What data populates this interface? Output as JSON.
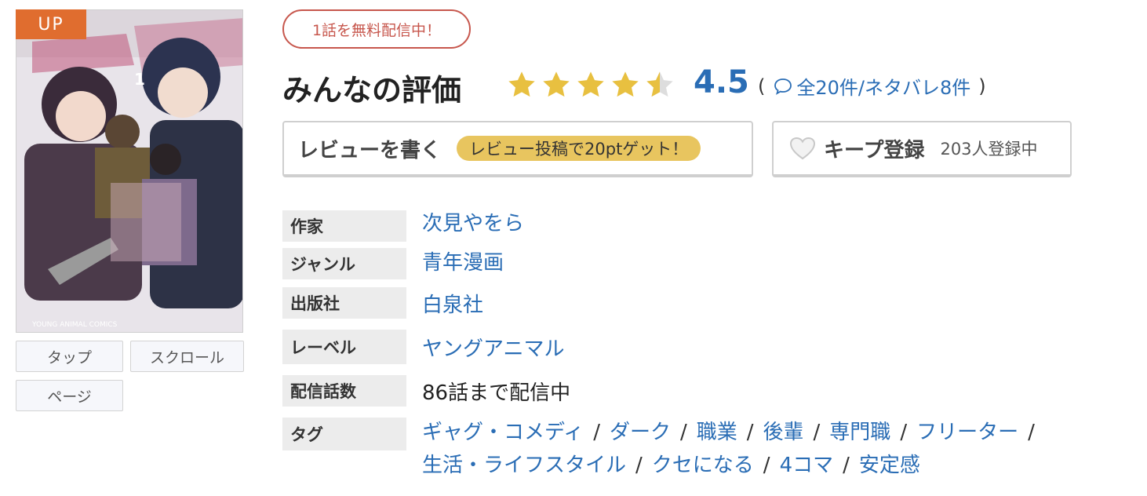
{
  "cover": {
    "badge": "UP",
    "modes": [
      "タップ",
      "スクロール",
      "ページ"
    ]
  },
  "free_notice": "1話を無料配信中！",
  "rating": {
    "title": "みんなの評価",
    "score": "4.5",
    "stars_value": 4.5,
    "star_color": "#e8c040",
    "paren_open": "(",
    "reviews_link": "全20件/ネタバレ8件",
    "paren_close": ")"
  },
  "review_button": {
    "label": "レビューを書く",
    "promo": "レビュー投稿で20ptゲット！"
  },
  "keep_button": {
    "label": "キープ登録",
    "count": "203人登録中"
  },
  "info": {
    "author_label": "作家",
    "author": "次見やをら",
    "genre_label": "ジャンル",
    "genre": "青年漫画",
    "publisher_label": "出版社",
    "publisher": "白泉社",
    "imprint_label": "レーベル",
    "imprint": "ヤングアニマル",
    "episodes_label": "配信話数",
    "episodes": "86話まで配信中",
    "tags_label": "タグ",
    "tags": [
      "ギャグ・コメディ",
      "ダーク",
      "職業",
      "後輩",
      "専門職",
      "フリーター",
      "生活・ライフスタイル",
      "クセになる",
      "4コマ",
      "安定感"
    ]
  },
  "colors": {
    "link": "#2a6db5",
    "badge": "#e06d2f",
    "free_border": "#c7574d",
    "promo_bg": "#e8c55f"
  }
}
